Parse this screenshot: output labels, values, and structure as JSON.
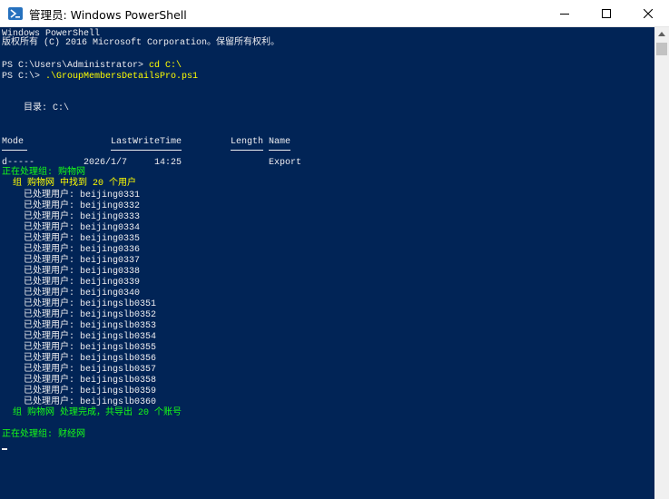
{
  "window": {
    "title": "管理员: Windows PowerShell"
  },
  "icons": {
    "app": "powershell-icon",
    "minimize": "minimize-icon",
    "maximize": "maximize-icon",
    "close": "close-icon",
    "scroll_up": "scroll-up-arrow-icon"
  },
  "colors": {
    "console_bg": "#012456",
    "text": "#eeedf0",
    "command": "#ffff00",
    "output_green": "#16ff16"
  },
  "console": {
    "banner_1": "Windows PowerShell",
    "banner_2": "版权所有 (C) 2016 Microsoft Corporation。保留所有权利。",
    "prompt_1": "PS C:\\Users\\Administrator> ",
    "cmd_1": "cd C:\\",
    "prompt_2": "PS C:\\> ",
    "cmd_2": ".\\GroupMembersDetailsPro.ps1",
    "directory": "    目录: C:\\",
    "header_mode": "Mode",
    "header_lastwrite": "LastWriteTime",
    "header_length": "Length",
    "header_name": "Name",
    "row_mode": "d-----",
    "row_date": "2026/1/7",
    "row_time": "14:25",
    "row_name": "Export",
    "processing_1": "正在处理组: 购物网",
    "found": "  组 购物网 中找到 20 个用户",
    "users": [
      "    已处理用户: beijing0331",
      "    已处理用户: beijing0332",
      "    已处理用户: beijing0333",
      "    已处理用户: beijing0334",
      "    已处理用户: beijing0335",
      "    已处理用户: beijing0336",
      "    已处理用户: beijing0337",
      "    已处理用户: beijing0338",
      "    已处理用户: beijing0339",
      "    已处理用户: beijing0340",
      "    已处理用户: beijingslb0351",
      "    已处理用户: beijingslb0352",
      "    已处理用户: beijingslb0353",
      "    已处理用户: beijingslb0354",
      "    已处理用户: beijingslb0355",
      "    已处理用户: beijingslb0356",
      "    已处理用户: beijingslb0357",
      "    已处理用户: beijingslb0358",
      "    已处理用户: beijingslb0359",
      "    已处理用户: beijingslb0360"
    ],
    "done": "  组 购物网 处理完成，共导出 20 个账号",
    "processing_2": "正在处理组: 财经网"
  }
}
